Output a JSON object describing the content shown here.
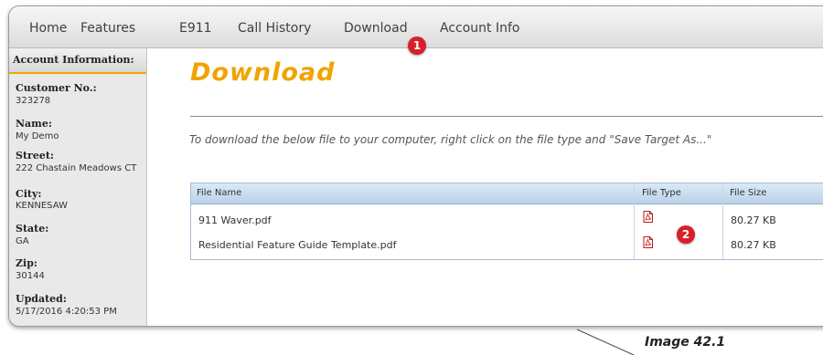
{
  "nav": {
    "items": [
      {
        "label": "Home"
      },
      {
        "label": "Features"
      },
      {
        "label": "E911"
      },
      {
        "label": "Call History"
      },
      {
        "label": "Download"
      },
      {
        "label": "Account Info"
      }
    ]
  },
  "sidebar": {
    "header": "Account Information:",
    "fields": [
      {
        "label": "Customer No.:",
        "value": "323278"
      },
      {
        "label": "Name:",
        "value": "My Demo"
      },
      {
        "label": "Street:",
        "value": "222 Chastain Meadows CT"
      },
      {
        "label": "City:",
        "value": "KENNESAW"
      },
      {
        "label": "State:",
        "value": "GA"
      },
      {
        "label": "Zip:",
        "value": "30144"
      },
      {
        "label": "Updated:",
        "value": "5/17/2016 4:20:53 PM"
      }
    ]
  },
  "main": {
    "title": "Download",
    "instructions": "To download the below file to your computer, right click on the file type and \"Save Target As...\"",
    "table": {
      "columns": [
        "File Name",
        "File Type",
        "File Size"
      ],
      "rows": [
        {
          "name": "911 Waver.pdf",
          "type_icon": "pdf-icon",
          "size": "80.27 KB"
        },
        {
          "name": "Residential Feature Guide Template.pdf",
          "type_icon": "pdf-icon",
          "size": "80.27 KB"
        }
      ]
    }
  },
  "callouts": {
    "one": "1",
    "two": "2"
  },
  "caption": "Image 42.1",
  "colors": {
    "accent": "#f0a400",
    "callout": "#d8202a",
    "table_header": "#bcd3ea"
  }
}
